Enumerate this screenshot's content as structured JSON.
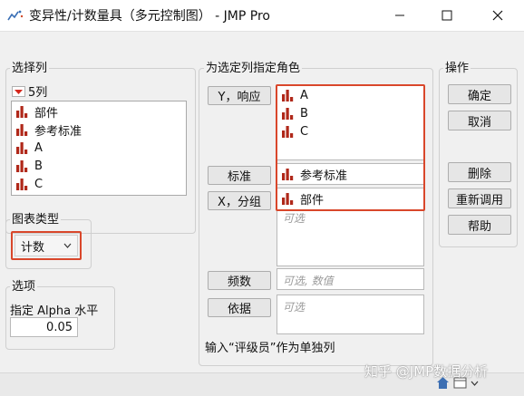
{
  "window": {
    "title": "变异性/计数量具（多元控制图） - JMP Pro",
    "controls": [
      "minimize",
      "maximize",
      "close"
    ]
  },
  "select_columns": {
    "title": "选择列",
    "count_label": "5列",
    "items": [
      "部件",
      "参考标准",
      "A",
      "B",
      "C"
    ]
  },
  "chart_type": {
    "title": "图表类型",
    "selected": "计数"
  },
  "options": {
    "title": "选项",
    "alpha_label": "指定 Alpha 水平",
    "alpha_value": "0.05"
  },
  "role_panel": {
    "title": "为选定列指定角色",
    "y_button": "Y，响应",
    "y_items": [
      "A",
      "B",
      "C"
    ],
    "standard_button": "标准",
    "standard_item": "参考标准",
    "x_button": "X，分组",
    "x_item": "部件",
    "x_placeholder": "可选",
    "freq_button": "频数",
    "freq_placeholder": "可选, 数值",
    "by_button": "依据",
    "by_placeholder": "可选",
    "footer_text": "输入“评级员”作为单独列"
  },
  "actions": {
    "title": "操作",
    "ok": "确定",
    "cancel": "取消",
    "remove": "删除",
    "recall": "重新调用",
    "help": "帮助"
  },
  "watermark": "知乎 @JMP数据分析",
  "colors": {
    "bar_icon": "#b0281a",
    "highlight": "#d9472b"
  }
}
